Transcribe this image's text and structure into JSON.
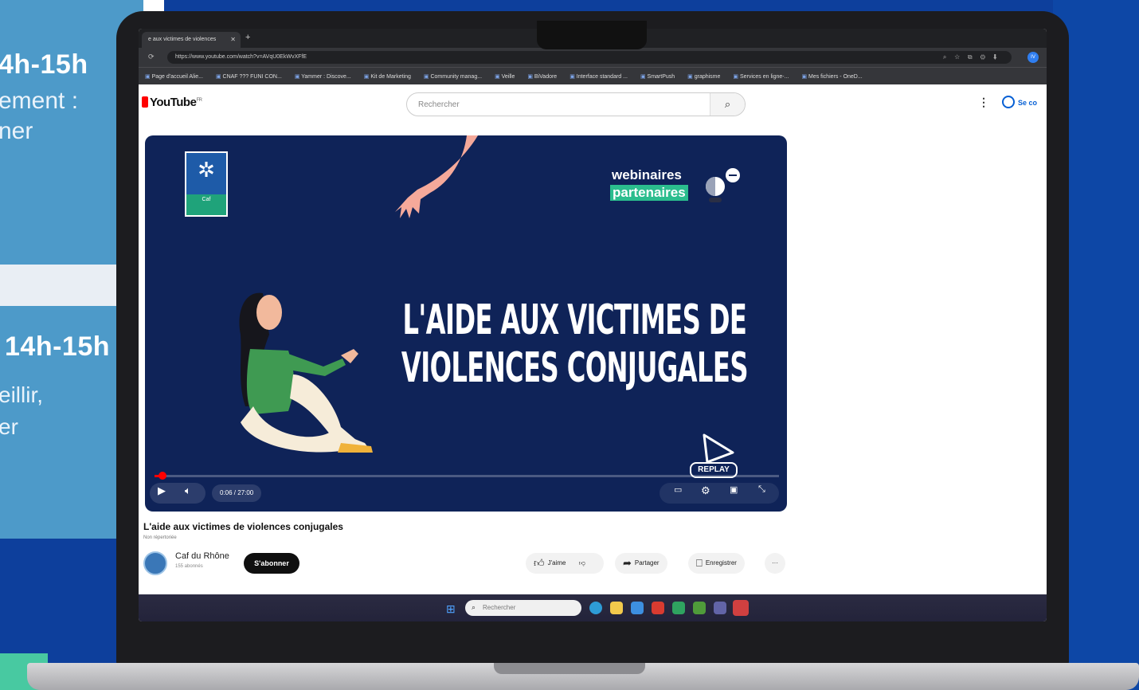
{
  "slide": {
    "card1_time": "4h-15h",
    "card1_line1": "ement :",
    "card1_line2": "ner",
    "card2_time": "14h-15h",
    "card2_line1": "eillir,",
    "card2_line2": "er"
  },
  "browser": {
    "tab_title": "e aux victimes de violences",
    "url": "https://www.youtube.com/watch?v=AVqU0EkWvXFfE",
    "profile_initials": "IV",
    "bookmarks": [
      "Page d'accueil Alie...",
      "CNAF ??? FUNI CON...",
      "Yammer : Discove...",
      "Kit de Marketing",
      "Community manag...",
      "Veille",
      "BiVadore",
      "Interface standard ...",
      "SmartPush",
      "graphisme",
      "Services en ligne-...",
      "Mes fichiers - OneD..."
    ]
  },
  "youtube": {
    "logo_text": "YouTube",
    "logo_country": "FR",
    "search_placeholder": "Rechercher",
    "signin_label": "Se co"
  },
  "video": {
    "badge_line1": "webinaires",
    "badge_line2": "partenaires",
    "headline_line1": "L'AIDE AUX VICTIMES DE",
    "headline_line2": "VIOLENCES CONJUGALES",
    "replay_label": "REPLAY",
    "time": "0:06 / 27:00",
    "progress": 0.004,
    "caf_logo_text": "Caf"
  },
  "below": {
    "title": "L'aide aux victimes de violences conjugales",
    "sub": "Non répertoriée",
    "channel": "Caf du Rhône",
    "subscribers": "155 abonnés",
    "subscribe_label": "S'abonner",
    "like_label": "J'aime",
    "share_label": "Partager",
    "save_label": "Enregistrer",
    "more_label": "···"
  },
  "taskbar": {
    "search_placeholder": "Rechercher"
  }
}
